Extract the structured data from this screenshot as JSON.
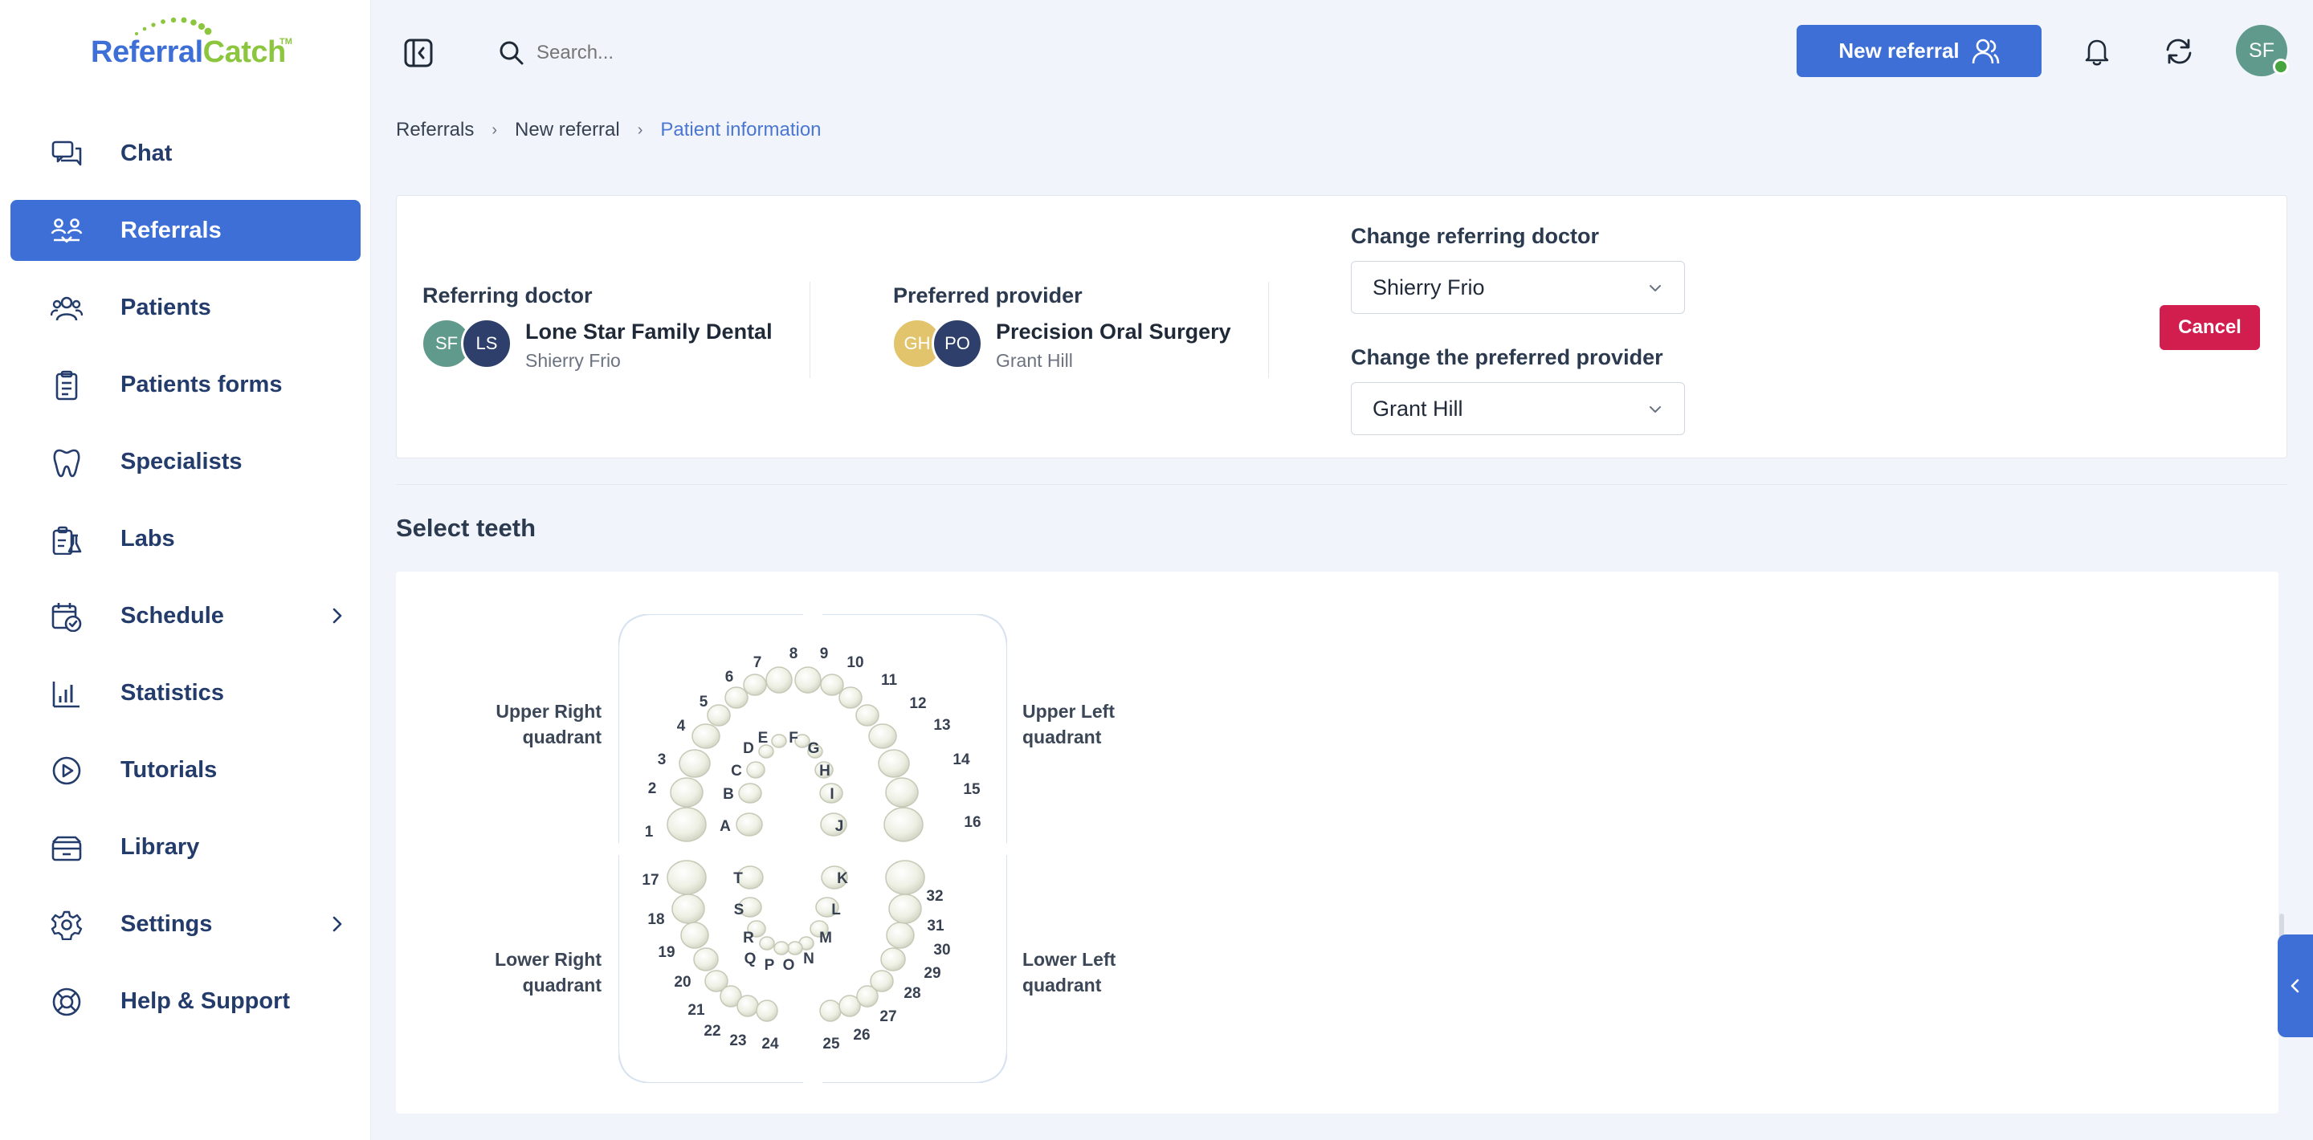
{
  "app": {
    "brand_part1": "Referral",
    "brand_part2": "Catch",
    "brand_tm": "TM"
  },
  "sidebar": {
    "items": [
      {
        "label": "Chat",
        "icon": "chat-icon",
        "active": false
      },
      {
        "label": "Referrals",
        "icon": "referrals-icon",
        "active": true
      },
      {
        "label": "Patients",
        "icon": "patients-icon",
        "active": false
      },
      {
        "label": "Patients forms",
        "icon": "clipboard-icon",
        "active": false
      },
      {
        "label": "Specialists",
        "icon": "tooth-icon",
        "active": false
      },
      {
        "label": "Labs",
        "icon": "lab-icon",
        "active": false
      },
      {
        "label": "Schedule",
        "icon": "calendar-check-icon",
        "active": false,
        "expandable": true
      },
      {
        "label": "Statistics",
        "icon": "bar-chart-icon",
        "active": false
      },
      {
        "label": "Tutorials",
        "icon": "play-icon",
        "active": false
      },
      {
        "label": "Library",
        "icon": "library-icon",
        "active": false
      },
      {
        "label": "Settings",
        "icon": "gear-icon",
        "active": false,
        "expandable": true
      },
      {
        "label": "Help & Support",
        "icon": "lifebuoy-icon",
        "active": false
      }
    ]
  },
  "topbar": {
    "search_placeholder": "Search...",
    "new_referral_label": "New referral",
    "user_initials": "SF"
  },
  "breadcrumb": [
    "Referrals",
    "New referral",
    "Patient information"
  ],
  "referral": {
    "referring_doctor": {
      "label": "Referring doctor",
      "initials": [
        "SF",
        "LS"
      ],
      "name": "Lone Star Family Dental",
      "sub": "Shierry Frio"
    },
    "preferred_provider": {
      "label": "Preferred provider",
      "initials": [
        "GH",
        "PO"
      ],
      "name": "Precision Oral Surgery",
      "sub": "Grant Hill"
    },
    "change_doctor_label": "Change referring doctor",
    "change_doctor_value": "Shierry Frio",
    "change_provider_label": "Change the preferred provider",
    "change_provider_value": "Grant Hill",
    "cancel_label": "Cancel"
  },
  "teeth": {
    "title": "Select teeth",
    "quadrants": {
      "upper_right": [
        "Upper Right",
        "quadrant"
      ],
      "upper_left": [
        "Upper Left",
        "quadrant"
      ],
      "lower_right": [
        "Lower Right",
        "quadrant"
      ],
      "lower_left": [
        "Lower Left",
        "quadrant"
      ]
    },
    "permanent": [
      "1",
      "2",
      "3",
      "4",
      "5",
      "6",
      "7",
      "8",
      "9",
      "10",
      "11",
      "12",
      "13",
      "14",
      "15",
      "16",
      "17",
      "18",
      "19",
      "20",
      "21",
      "22",
      "23",
      "24",
      "25",
      "26",
      "27",
      "28",
      "29",
      "30",
      "31",
      "32"
    ],
    "primary": [
      "A",
      "B",
      "C",
      "D",
      "E",
      "F",
      "G",
      "H",
      "I",
      "J",
      "K",
      "L",
      "M",
      "N",
      "O",
      "P",
      "Q",
      "R",
      "S",
      "T"
    ]
  },
  "colors": {
    "primary": "#3d6fd6",
    "brand_green": "#8cc63f",
    "danger": "#d11e4f",
    "online": "#46a53c"
  }
}
